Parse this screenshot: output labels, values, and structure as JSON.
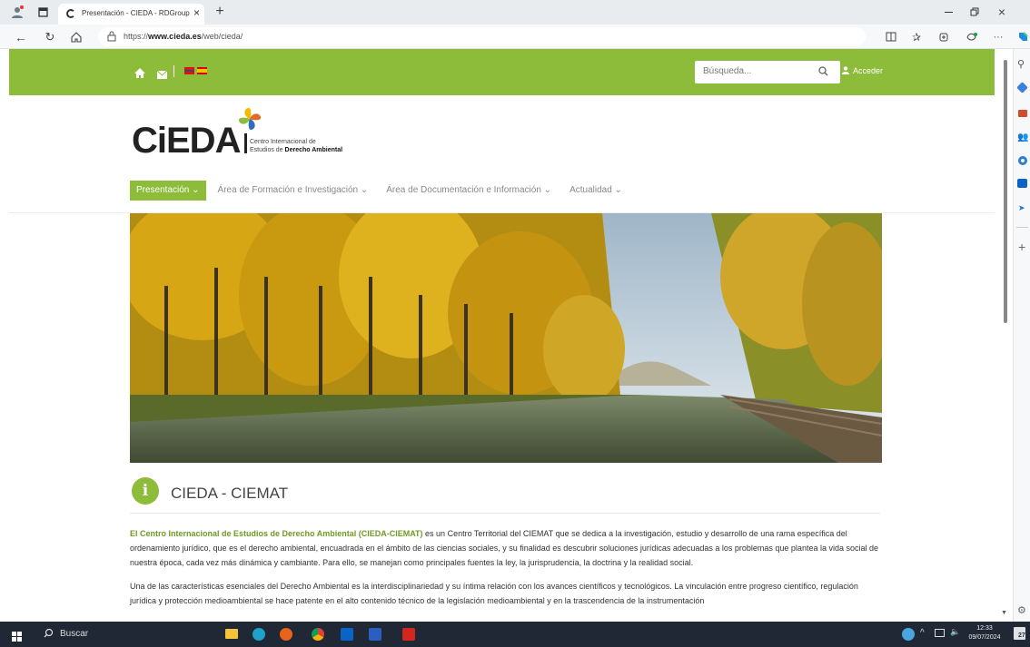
{
  "browser": {
    "tab_title": "Presentación - CIEDA - RDGroup",
    "url_prefix": "https://",
    "url_domain": "www.cieda.es",
    "url_path": "/web/cieda/",
    "new_tab_label": "+",
    "close_label": "×",
    "more_label": "···"
  },
  "site": {
    "search_placeholder": "Búsqueda...",
    "login_label": "Acceder",
    "logo_text": "CiEDA",
    "logo_sub1": "Centro Internacional de",
    "logo_sub2_prefix": "Estudios de ",
    "logo_sub2_bold": "Derecho Ambiental",
    "nav": [
      {
        "label": "Presentación"
      },
      {
        "label": "Área de Formación e Investigación"
      },
      {
        "label": "Área de Documentación e Información"
      },
      {
        "label": "Actualidad"
      }
    ],
    "section_badge": "i",
    "section_title": "CIEDA - CIEMAT",
    "para1_lead": "El Centro Internacional de Estudios de Derecho Ambiental (CIEDA-CIEMAT)",
    "para1_rest": " es un Centro Territorial del CIEMAT que se dedica a la investigación, estudio y desarrollo de una rama específica del ordenamiento jurídico, que es el derecho ambiental, encuadrada en el ámbito de las ciencias sociales, y su finalidad es descubrir soluciones jurídicas adecuadas a los problemas que plantea la vida social de nuestra época, cada vez más dinámica y cambiante. Para ello, se manejan como principales fuentes la ley, la jurisprudencia, la doctrina y la realidad social.",
    "para2": "Una de las características esenciales del Derecho Ambiental es la interdisciplinariedad y su íntima relación con los avances científicos y tecnológicos. La vinculación entre progreso científico, regulación jurídica y protección medioambiental se hace patente en el alto contenido técnico de la legislación medioambiental y en la trascendencia de la instrumentación"
  },
  "taskbar": {
    "search_label": "Buscar",
    "time": "12:33",
    "date": "09/07/2024",
    "notif_count": "27"
  },
  "colors": {
    "brand_green": "#8dbb3a",
    "taskbar": "#1f2834"
  }
}
